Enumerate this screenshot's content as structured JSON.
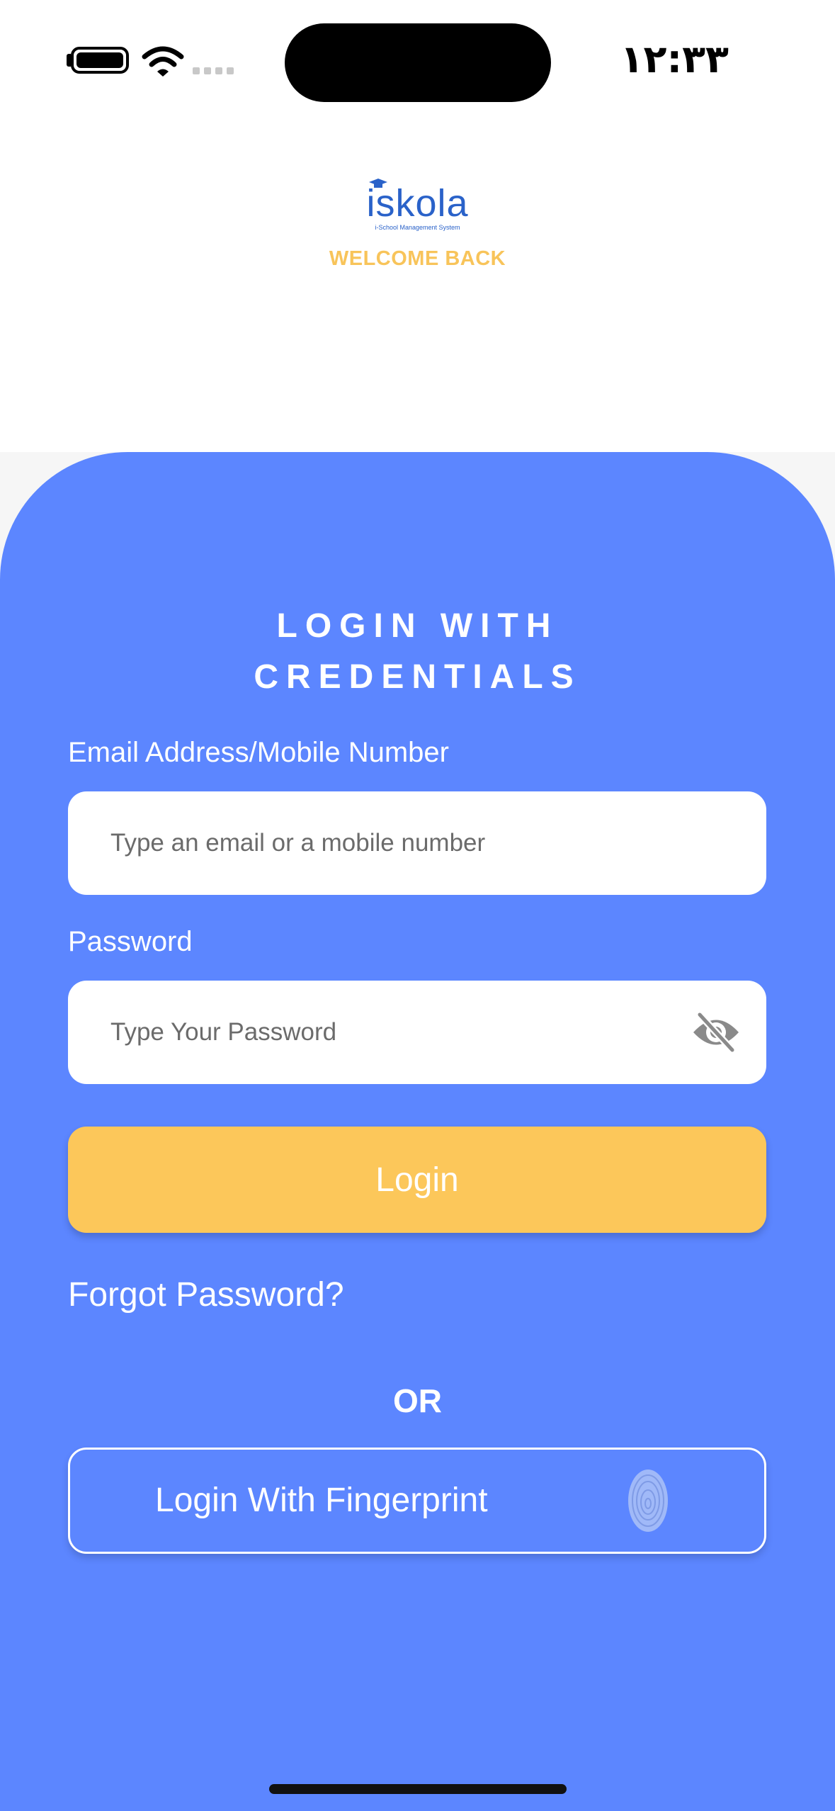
{
  "status_bar": {
    "time": "۱۲:۳۳",
    "battery_icon": "battery-icon",
    "wifi_icon": "wifi-icon",
    "signal_icon": "cellular-signal-icon"
  },
  "header": {
    "logo_text": "iskola",
    "logo_tagline": "i-School Management System",
    "welcome": "WELCOME BACK"
  },
  "form": {
    "title_line1": "LOGIN WITH",
    "title_line2": "CREDENTIALS",
    "email_label": "Email Address/Mobile Number",
    "email_placeholder": "Type an email or a mobile number",
    "email_value": "",
    "password_label": "Password",
    "password_placeholder": "Type Your Password",
    "password_value": "",
    "password_toggle_icon": "eye-slash-icon",
    "login_label": "Login",
    "forgot_label": "Forgot Password?",
    "or_label": "OR",
    "fingerprint_label": "Login With Fingerprint",
    "fingerprint_icon": "fingerprint-icon"
  },
  "colors": {
    "primary_blue": "#5c86ff",
    "accent_yellow": "#fcc75a",
    "welcome_yellow": "#f8c45a",
    "logo_blue": "#2a62c9"
  }
}
